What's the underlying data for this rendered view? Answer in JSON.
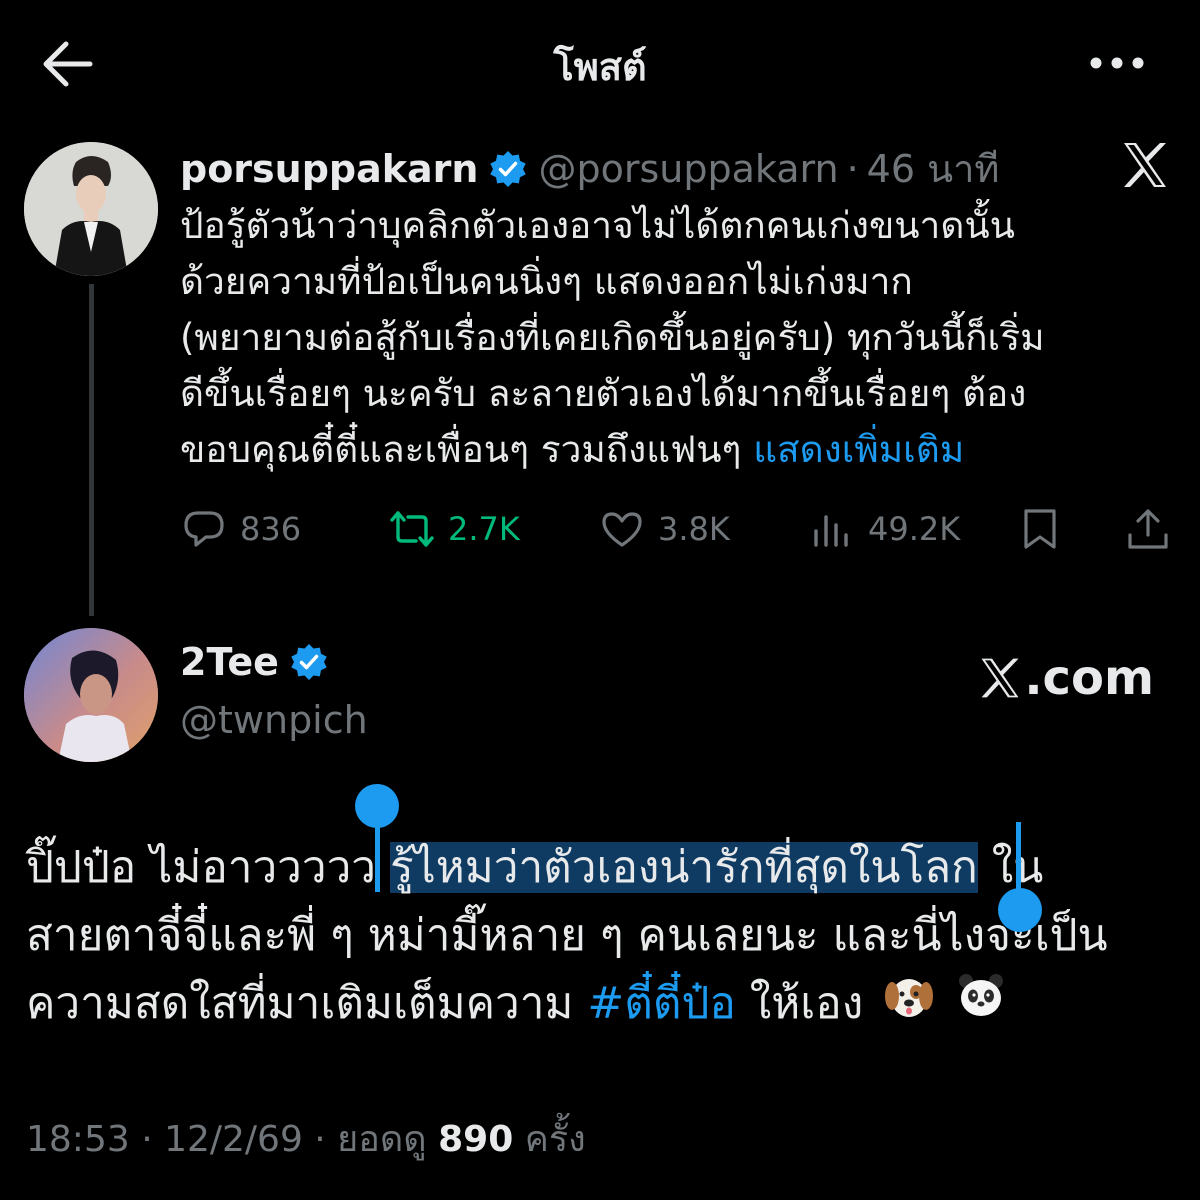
{
  "header": {
    "title": "โพสต์"
  },
  "quoted_post": {
    "name": "porsuppakarn",
    "handle": "@porsuppakarn",
    "separator": "·",
    "time": "46 นาที",
    "lines": [
      "ป้อรู้ตัวน้าว่าบุคลิกตัวเองอาจไม่ได้ตกคนเก่งขนาดนั้น",
      "ด้วยความที่ป้อเป็นคนนิ่งๆ แสดงออกไม่เก่งมาก",
      "(พยายามต่อสู้กับเรื่องที่เคยเกิดขึ้นอยู่ครับ) ทุกวันนี้ก็เริ่ม",
      "ดีขึ้นเรื่อยๆ นะครับ ละลายตัวเองได้มากขึ้นเรื่อยๆ ต้อง",
      "ขอบคุณตี๋ตี๋และเพื่อนๆ รวมถึงแฟนๆ "
    ],
    "show_more": "แสดงเพิ่มเติม",
    "stats": {
      "replies": "836",
      "reposts": "2.7K",
      "likes": "3.8K",
      "views": "49.2K"
    }
  },
  "main_post": {
    "name": "2Tee",
    "handle": "@twnpich",
    "site": ".com",
    "line1_before": "ปิ๊ปป๋อ ไม่อาววววว ",
    "line1_selected": "รู้ไหมว่าตัวเองน่ารักที่สุดในโลก",
    "line1_after": " ใน",
    "line2": "สายตาจี๋จี๋และพี่ ๆ หม่ามี๊หลาย ๆ คนเลยนะ และนี่ไงจะเป็น",
    "line3_before": "ความสดใสที่มาเติมเต็มความ ",
    "hashtag": "#ตี๋ตี๋ป๋อ",
    "line3_after": " ให้เอง",
    "emojis": [
      "dog-face",
      "panda-face"
    ],
    "timestamp": "18:53 · 12/2/69 · ยอดดู",
    "view_count": "890",
    "view_unit": "ครั้ง"
  },
  "colors": {
    "background": "#000000",
    "accent": "#1d9bf0",
    "muted": "#71767b",
    "repost_green": "#00ba7c",
    "selection": "#0f3b63"
  }
}
